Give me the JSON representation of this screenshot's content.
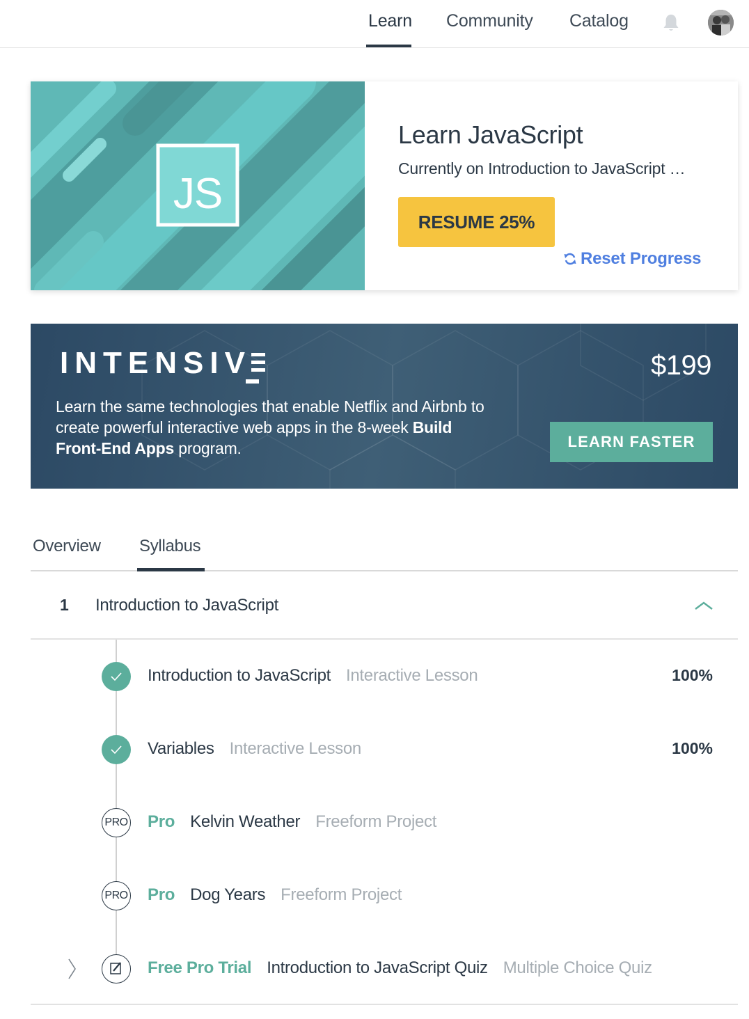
{
  "nav": {
    "items": [
      {
        "label": "Learn",
        "active": true
      },
      {
        "label": "Community",
        "active": false
      },
      {
        "label": "Catalog",
        "active": false
      }
    ],
    "notifications_icon": "bell-icon",
    "avatar_icon": "user-avatar"
  },
  "course": {
    "badge": "JS",
    "title": "Learn JavaScript",
    "current": "Currently on Introduction to JavaScript …",
    "resume_label": "RESUME 25%",
    "resume_progress": 0.25,
    "reset_label": "Reset Progress",
    "reset_icon": "refresh-icon"
  },
  "intensive": {
    "logo": "INTENSIV",
    "price": "$199",
    "description_pre": "Learn the same technologies that enable Netflix and Airbnb to create powerful interactive web apps in the 8-week ",
    "description_bold": "Build Front-End Apps",
    "description_post": " program.",
    "cta_label": "LEARN FASTER"
  },
  "tabs": [
    {
      "label": "Overview",
      "active": false
    },
    {
      "label": "Syllabus",
      "active": true
    }
  ],
  "module": {
    "number": "1",
    "title": "Introduction to JavaScript",
    "expanded": true,
    "lessons": [
      {
        "status": "complete",
        "tag": "",
        "name": "Introduction to JavaScript",
        "type": "Interactive Lesson",
        "progress": "100%"
      },
      {
        "status": "complete",
        "tag": "",
        "name": "Variables",
        "type": "Interactive Lesson",
        "progress": "100%"
      },
      {
        "status": "pro",
        "icon_label": "PRO",
        "tag": "Pro",
        "name": "Kelvin Weather",
        "type": "Freeform Project",
        "progress": ""
      },
      {
        "status": "pro",
        "icon_label": "PRO",
        "tag": "Pro",
        "name": "Dog Years",
        "type": "Freeform Project",
        "progress": ""
      },
      {
        "status": "quiz",
        "tag": "Free Pro Trial",
        "name": "Introduction to JavaScript Quiz",
        "type": "Multiple Choice Quiz",
        "progress": ""
      }
    ]
  },
  "colors": {
    "primary_text": "#2b3845",
    "accent_green": "#5cae9c",
    "resume_yellow": "#f6c43f",
    "link_blue": "#4f7fe0",
    "banner_navy": "#2c4964"
  }
}
